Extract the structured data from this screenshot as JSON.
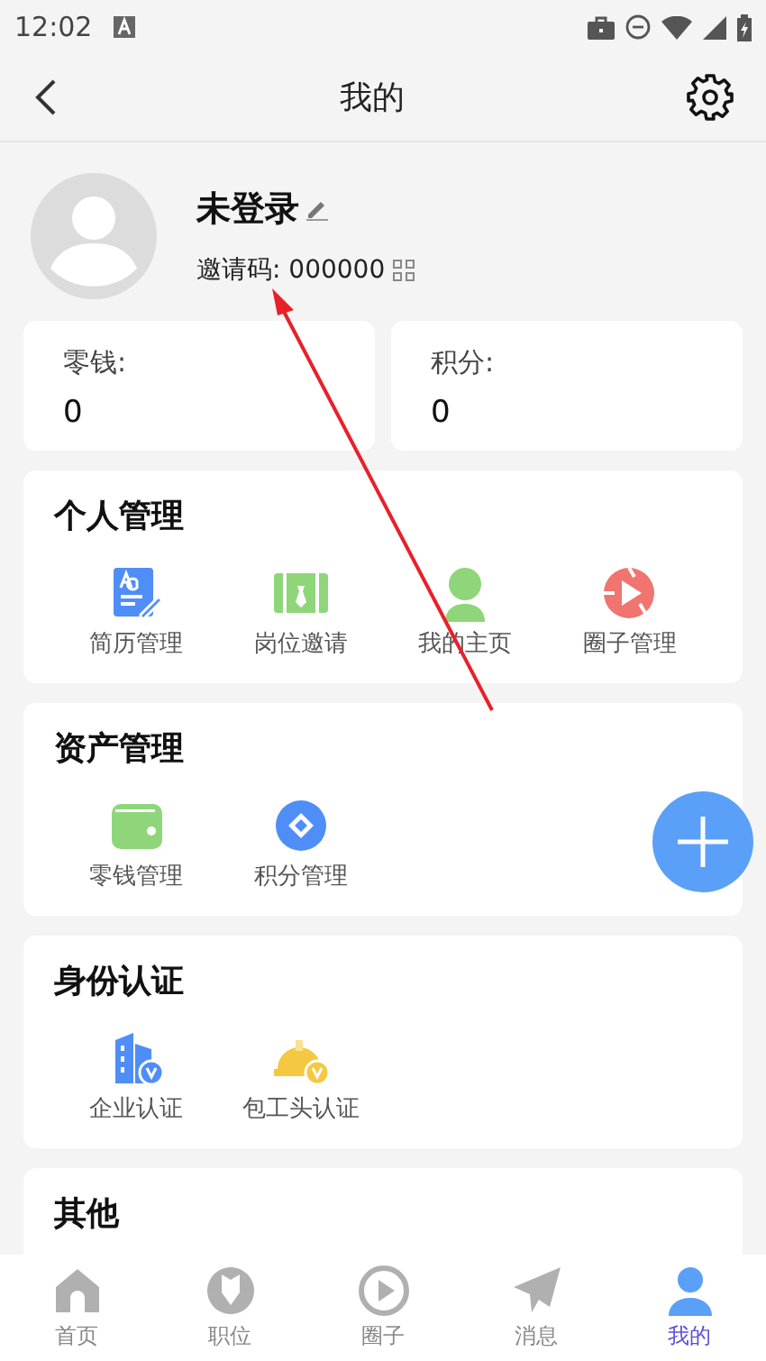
{
  "status_bar": {
    "time": "12:02"
  },
  "header": {
    "title": "我的"
  },
  "profile": {
    "name": "未登录",
    "invite_label": "邀请码: 000000"
  },
  "balances": [
    {
      "label": "零钱:",
      "value": "0"
    },
    {
      "label": "积分:",
      "value": "0"
    }
  ],
  "sections": [
    {
      "title": "个人管理",
      "items": [
        "简历管理",
        "岗位邀请",
        "我的主页",
        "圈子管理"
      ]
    },
    {
      "title": "资产管理",
      "items": [
        "零钱管理",
        "积分管理"
      ]
    },
    {
      "title": "身份认证",
      "items": [
        "企业认证",
        "包工头认证"
      ]
    },
    {
      "title": "其他"
    }
  ],
  "annotation": {
    "kind": "arrow"
  },
  "tabs": [
    {
      "label": "首页",
      "selected": false
    },
    {
      "label": "职位",
      "selected": false
    },
    {
      "label": "圈子",
      "selected": false
    },
    {
      "label": "消息",
      "selected": false
    },
    {
      "label": "我的",
      "selected": true
    }
  ]
}
